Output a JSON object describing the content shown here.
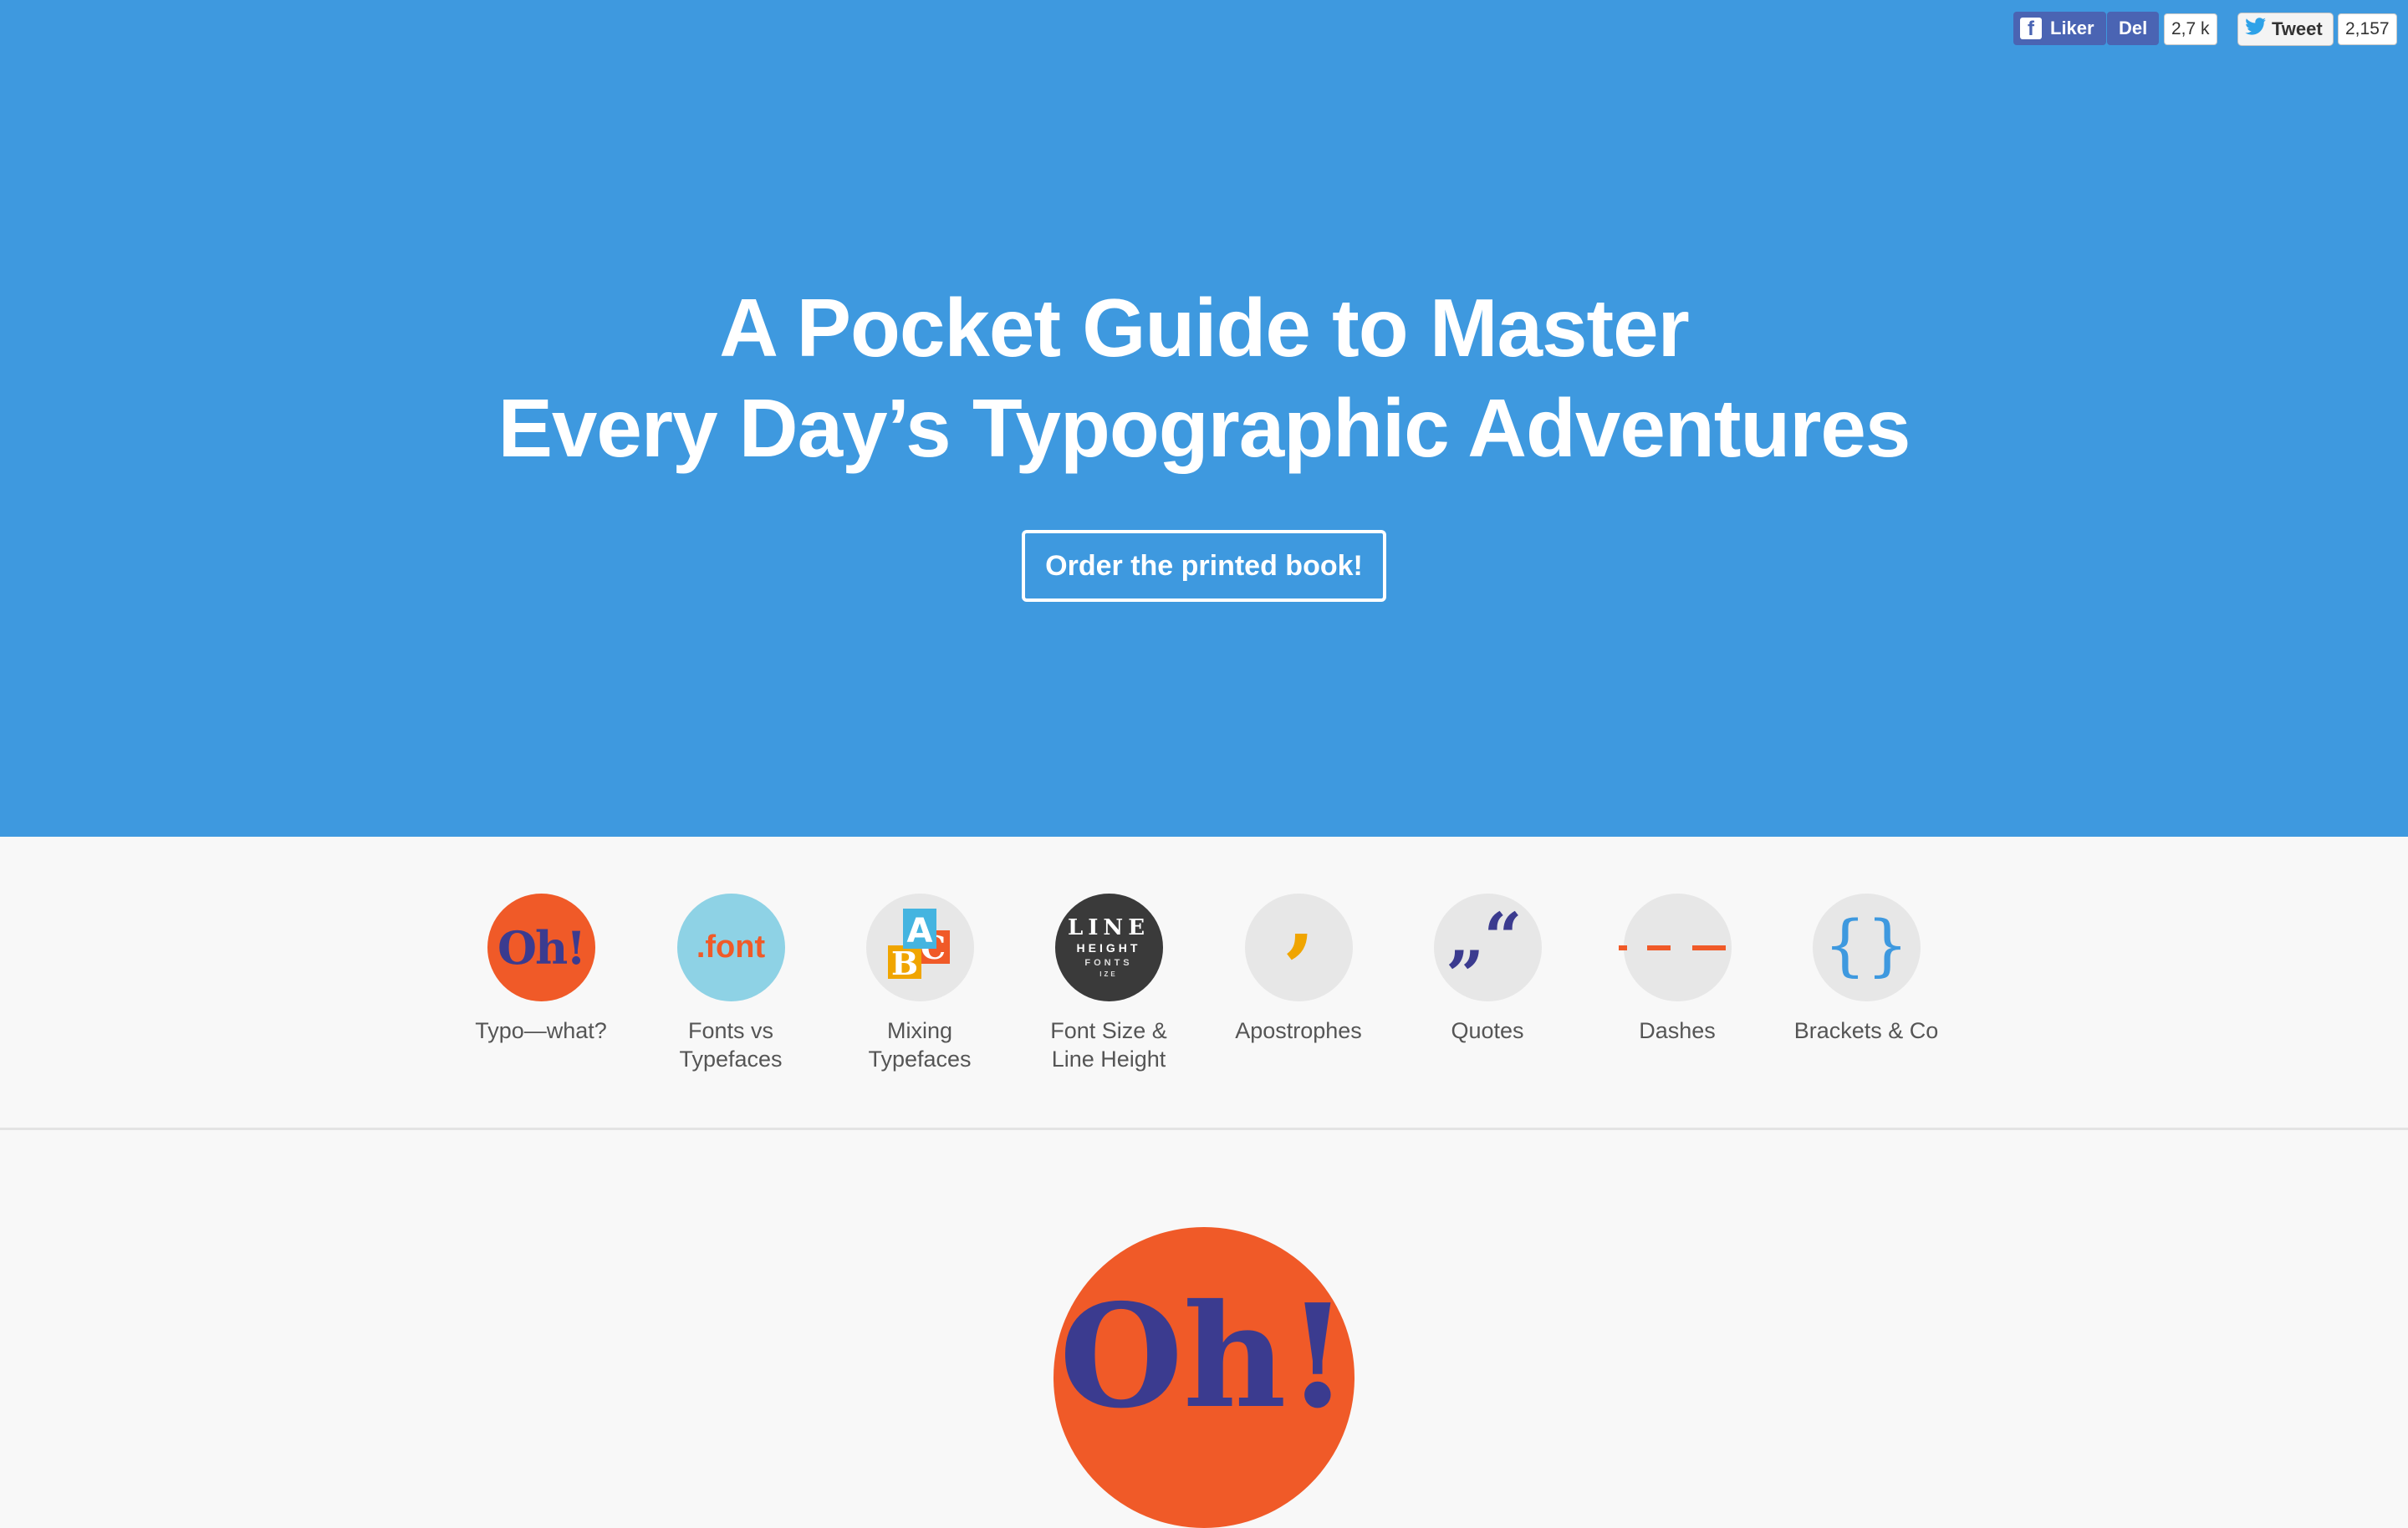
{
  "social": {
    "facebook_like": "Liker",
    "facebook_share": "Del",
    "facebook_count": "2,7 k",
    "tweet": "Tweet",
    "tweet_count": "2,157"
  },
  "hero": {
    "title_line1": "A Pocket Guide to Master",
    "title_line2": "Every Day’s Typographic Adventures",
    "cta": "Order the printed book!"
  },
  "nav": {
    "items": [
      {
        "label1": "Typo—what?",
        "label2": "",
        "icon": "oh-icon",
        "glyph": "Oh!"
      },
      {
        "label1": "Fonts vs",
        "label2": "Typefaces",
        "icon": "font-icon",
        "glyph": ".font"
      },
      {
        "label1": "Mixing",
        "label2": "Typefaces",
        "icon": "abc-blocks-icon",
        "glyph": "A B C"
      },
      {
        "label1": "Font Size &",
        "label2": "Line Height",
        "icon": "line-height-icon",
        "glyph_1": "LINE",
        "glyph_2": "HEIGHT",
        "glyph_3": "FONTS",
        "glyph_4": "IZE"
      },
      {
        "label1": "Apostrophes",
        "label2": "",
        "icon": "apostrophe-icon",
        "glyph": "’"
      },
      {
        "label1": "Quotes",
        "label2": "",
        "icon": "quotes-icon",
        "glyph_open": "„",
        "glyph_close": "“"
      },
      {
        "label1": "Dashes",
        "label2": "",
        "icon": "dashes-icon"
      },
      {
        "label1": "Brackets & Co",
        "label2": "",
        "icon": "brackets-icon",
        "glyph": "{}"
      }
    ]
  },
  "section": {
    "hero_glyph": "Oh!"
  },
  "colors": {
    "hero_bg": "#3e99df",
    "accent_orange": "#f05a28",
    "accent_indigo": "#3b3b8f",
    "accent_teal": "#8ed2e5",
    "accent_yellow": "#f0a500",
    "dark": "#3a3a3a",
    "light_grey": "#e7e7e7",
    "bracket_blue": "#3e99df"
  }
}
